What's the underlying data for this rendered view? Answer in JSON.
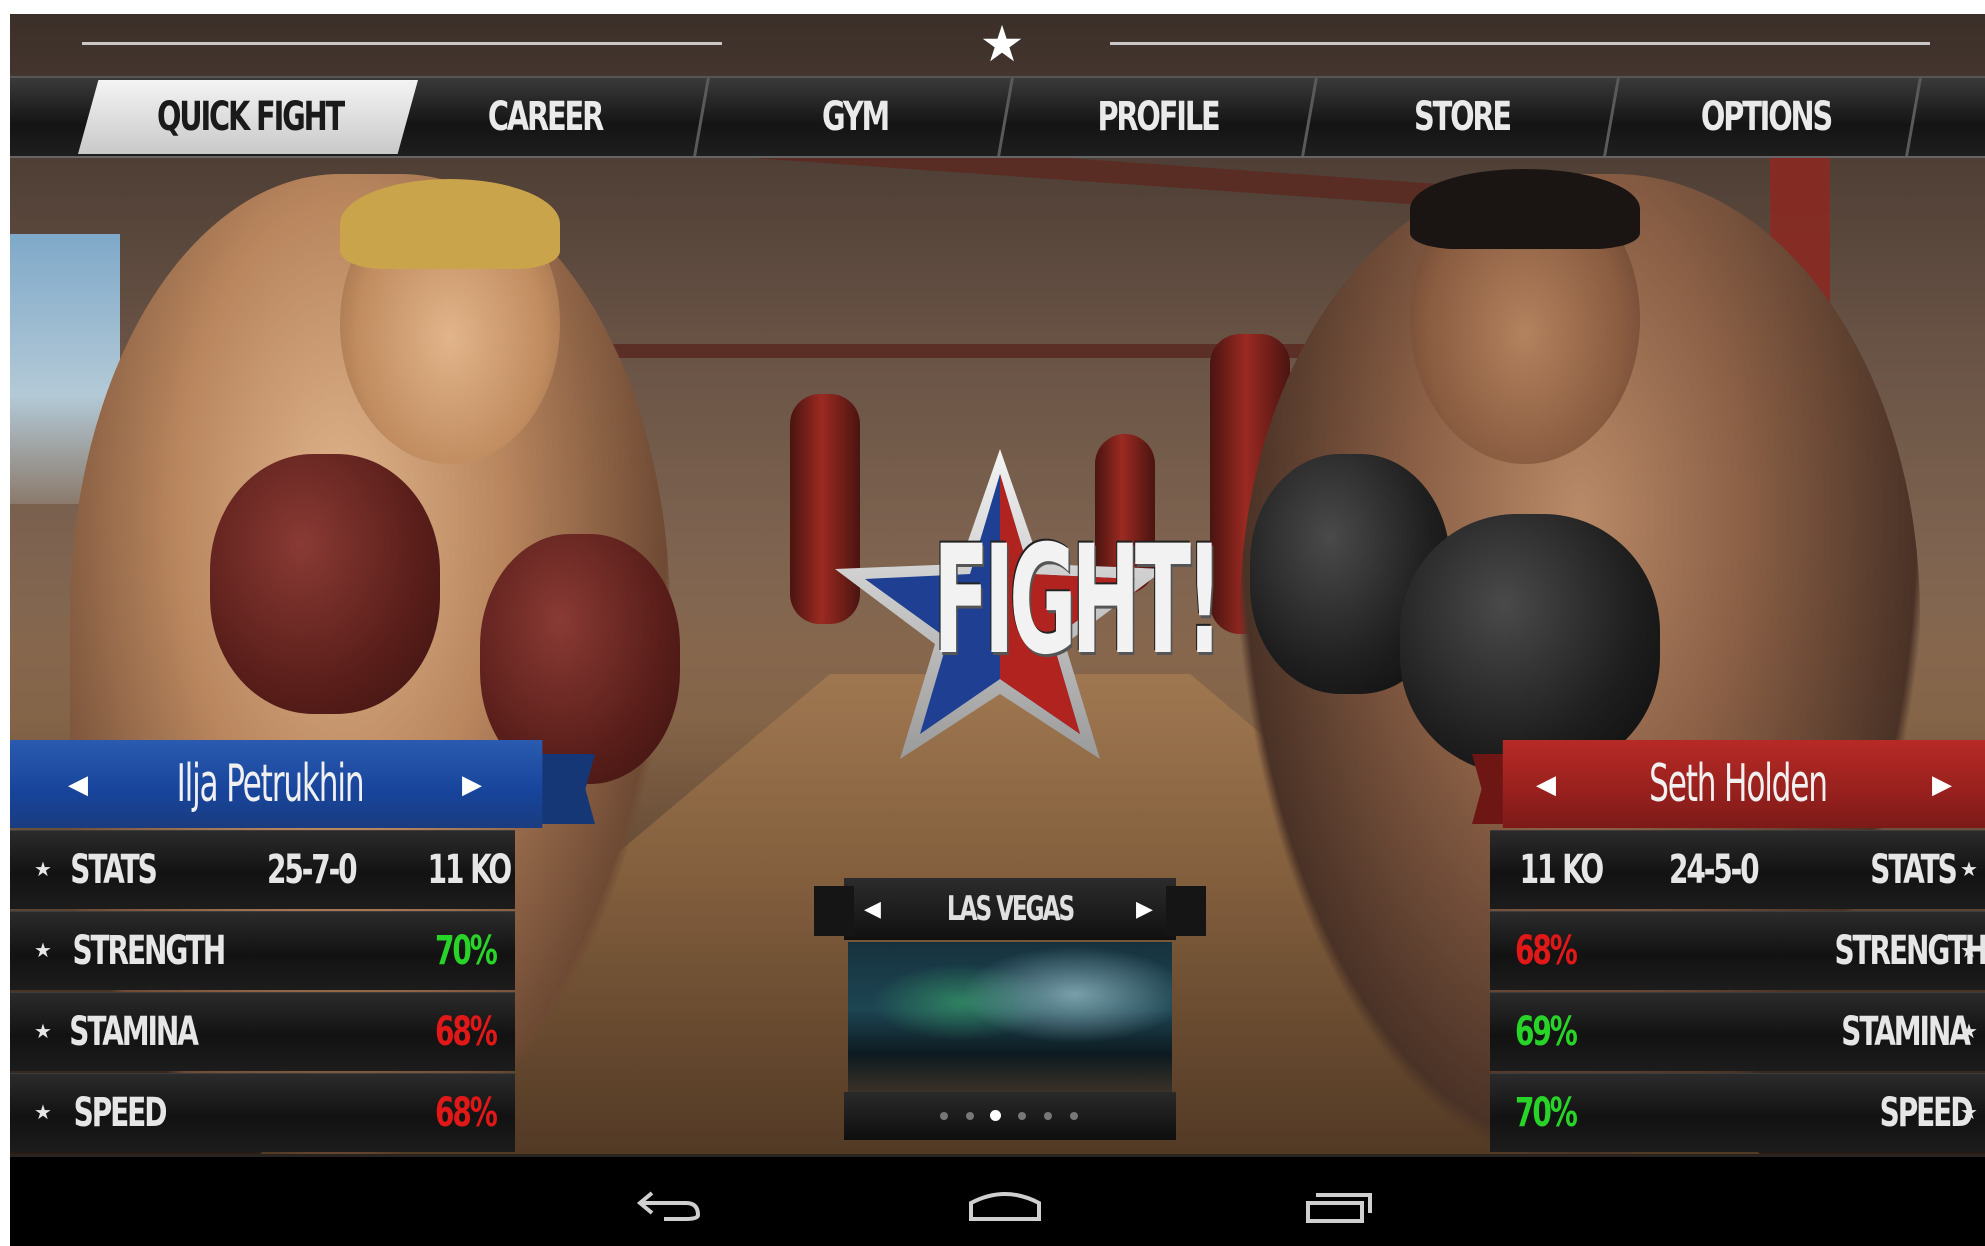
{
  "nav": {
    "tabs": [
      {
        "label": "QUICK FIGHT",
        "active": true
      },
      {
        "label": "CAREER",
        "active": false
      },
      {
        "label": "GYM",
        "active": false
      },
      {
        "label": "PROFILE",
        "active": false
      },
      {
        "label": "STORE",
        "active": false
      },
      {
        "label": "OPTIONS",
        "active": false
      }
    ]
  },
  "fight_button": {
    "label": "FIGHT!"
  },
  "left_fighter": {
    "name": "Ilja Petrukhin",
    "banner_color": "#1f4aa0",
    "record": "25-7-0",
    "ko": "11 KO",
    "stats_label": "STATS",
    "strength": {
      "label": "STRENGTH",
      "value": "70%",
      "color": "green"
    },
    "stamina": {
      "label": "STAMINA",
      "value": "68%",
      "color": "red"
    },
    "speed": {
      "label": "SPEED",
      "value": "68%",
      "color": "red"
    }
  },
  "right_fighter": {
    "name": "Seth Holden",
    "banner_color": "#a8231f",
    "record": "24-5-0",
    "ko": "11 KO",
    "stats_label": "STATS",
    "strength": {
      "label": "STRENGTH",
      "value": "68%",
      "color": "red"
    },
    "stamina": {
      "label": "STAMINA",
      "value": "69%",
      "color": "green"
    },
    "speed": {
      "label": "SPEED",
      "value": "70%",
      "color": "green"
    }
  },
  "venue": {
    "title": "LAS VEGAS",
    "page_count": 6,
    "current_page": 3
  },
  "system_nav": {
    "icons": [
      "back-icon",
      "home-icon",
      "recent-apps-icon"
    ]
  }
}
